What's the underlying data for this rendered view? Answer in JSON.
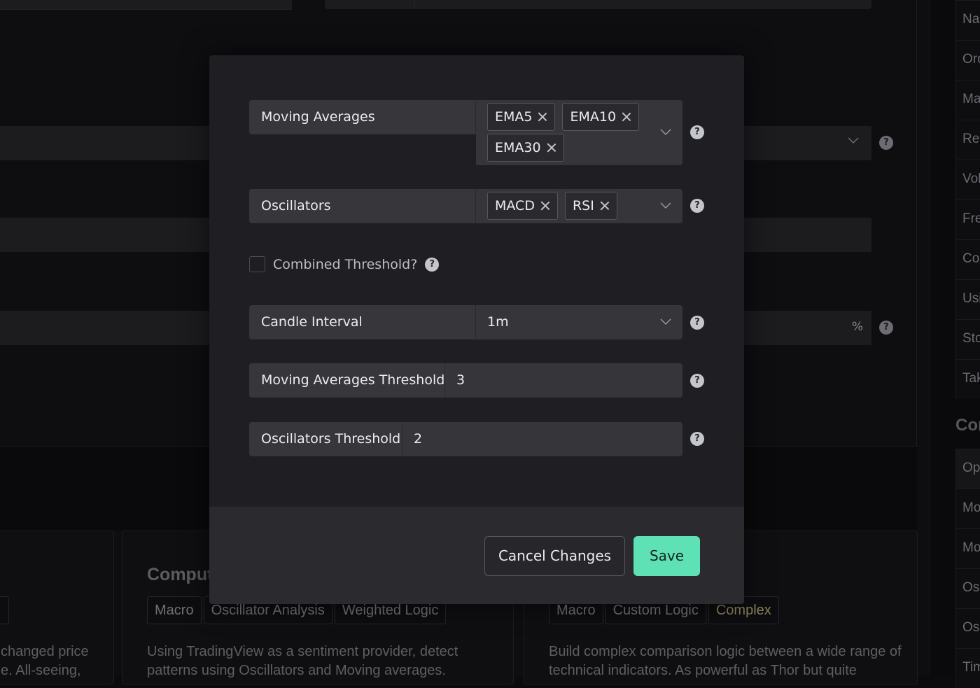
{
  "background": {
    "fields": [
      {
        "type": "select",
        "suffix": ""
      },
      {
        "type": "text",
        "suffix": ""
      },
      {
        "type": "text",
        "suffix": "%"
      }
    ],
    "help_glyph": "?",
    "chevron_icon": "chevron-down-icon",
    "cards": [
      {
        "title": "",
        "tags": [],
        "description_lines": [
          "changed price",
          "e. All-seeing,"
        ]
      },
      {
        "title": "Comput",
        "tags": [
          {
            "label": "Macro",
            "highlight": false
          },
          {
            "label": "Oscillator Analysis",
            "highlight": false
          },
          {
            "label": "Weighted Logic",
            "highlight": false
          }
        ],
        "description_lines": [
          "Using TradingView as a sentiment provider, detect",
          "patterns using Oscillators and Moving averages."
        ]
      },
      {
        "title": "",
        "tags": [
          {
            "label": "Macro",
            "highlight": false
          },
          {
            "label": "Custom Logic",
            "highlight": false
          },
          {
            "label": "Complex",
            "highlight": true
          }
        ],
        "description_lines": [
          "Build complex comparison logic between a wide range of",
          "technical indicators. As powerful as Thor but quite"
        ]
      }
    ],
    "sidebar": {
      "items_top": [
        "Nam",
        "Ord",
        "Max",
        "Re-",
        "Vol",
        "Fre",
        "Coi",
        "Usi",
        "Sto",
        "Tak"
      ],
      "heading": "Con",
      "items_bottom": [
        "Opt",
        "Mov",
        "Mov",
        "Osc",
        "Osc",
        "Tim"
      ],
      "active_bottom_index": 0
    }
  },
  "modal": {
    "moving_averages": {
      "label": "Moving Averages",
      "selected": [
        "EMA5",
        "EMA10",
        "EMA30"
      ],
      "help": "?"
    },
    "oscillators": {
      "label": "Oscillators",
      "selected": [
        "MACD",
        "RSI"
      ],
      "help": "?"
    },
    "combined_threshold": {
      "label": "Combined Threshold?",
      "checked": false,
      "help": "?"
    },
    "candle_interval": {
      "label": "Candle Interval",
      "value": "1m",
      "help": "?"
    },
    "moving_averages_threshold": {
      "label": "Moving Averages Threshold",
      "value": "3",
      "help": "?"
    },
    "oscillators_threshold": {
      "label": "Oscillators Threshold",
      "value": "2",
      "help": "?"
    },
    "footer": {
      "cancel_label": "Cancel Changes",
      "save_label": "Save"
    }
  },
  "colors": {
    "accent": "#5fe1b6",
    "modal_bg": "#1f1f23",
    "field_bg": "#36363b",
    "tag_highlight": "#8d7f5c"
  }
}
